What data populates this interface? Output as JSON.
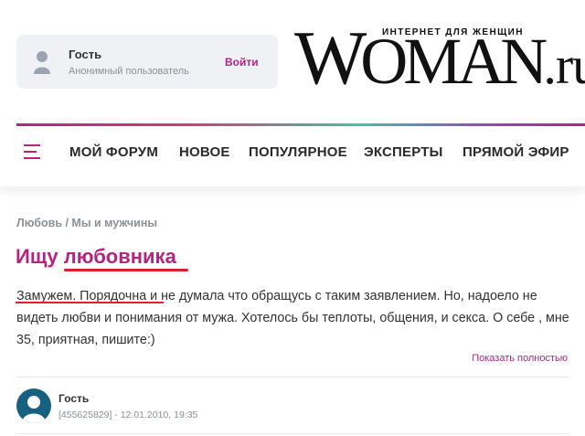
{
  "user": {
    "name": "Гость",
    "subtitle": "Анонимный пользователь",
    "login_label": "Войти"
  },
  "logo": {
    "tagline": "ИНТЕРНЕТ ДЛЯ ЖЕНЩИН",
    "brand_w": "W",
    "brand_rest": "OMAN",
    "brand_ru": ".ru"
  },
  "nav": {
    "items": [
      "МОЙ ФОРУМ",
      "НОВОЕ",
      "ПОПУЛЯРНОЕ",
      "ЭКСПЕРТЫ",
      "ПРЯМОЙ ЭФИР"
    ]
  },
  "breadcrumb": "Любовь / Мы и мужчины",
  "post": {
    "title": "Ищу любовника",
    "body": "Замужем. Порядочна и не думала что обращусь с таким заявлением. Но, надоело не видеть любви и понимания от мужа. Хотелось бы теплоты, общения, и секса. О себе , мне 35, приятная, пишите:)",
    "show_full_label": "Показать полностью"
  },
  "comment": {
    "author": "Гость",
    "meta": "[455625829] - 12.01.2010, 19:35"
  },
  "colors": {
    "accent": "#b6247f",
    "annotation_red": "#e0212b",
    "avatar_bg": "#17607f"
  }
}
